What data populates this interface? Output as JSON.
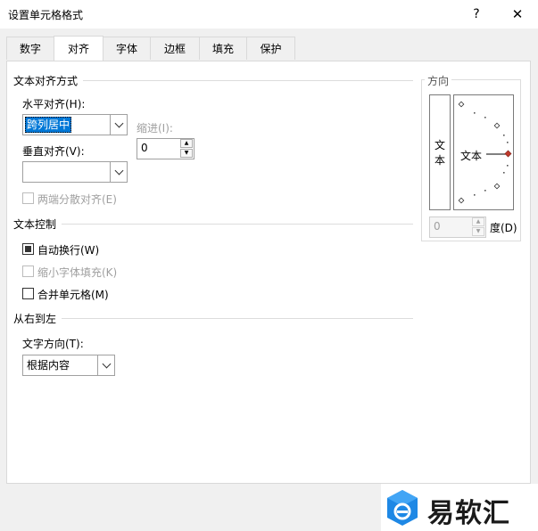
{
  "window": {
    "title": "设置单元格格式",
    "help_label": "?",
    "close_label": "✕"
  },
  "tabs": [
    {
      "label": "数字"
    },
    {
      "label": "对齐"
    },
    {
      "label": "字体"
    },
    {
      "label": "边框"
    },
    {
      "label": "填充"
    },
    {
      "label": "保护"
    }
  ],
  "alignment": {
    "section_title": "文本对齐方式",
    "horizontal_label": "水平对齐(H):",
    "horizontal_value": "跨列居中",
    "indent_label": "缩进(I):",
    "indent_value": "0",
    "vertical_label": "垂直对齐(V):",
    "vertical_value": "",
    "justify_distributed_label": "两端分散对齐(E)"
  },
  "text_control": {
    "section_title": "文本控制",
    "wrap_text_label": "自动换行(W)",
    "wrap_text_checked": true,
    "shrink_to_fit_label": "缩小字体填充(K)",
    "merge_cells_label": "合并单元格(M)"
  },
  "rtl": {
    "section_title": "从右到左",
    "direction_label": "文字方向(T):",
    "direction_value": "根据内容"
  },
  "orientation": {
    "group_title": "方向",
    "vertical_text_top": "文",
    "vertical_text_bottom": "本",
    "dial_text": "文本",
    "degrees_value": "0",
    "degrees_label": "度(D)"
  },
  "watermark": {
    "text": "易软汇",
    "colors": {
      "blue": "#1e88e5",
      "dark": "#1a1a1a"
    }
  },
  "colors": {
    "selection": "#0078d7",
    "dial_marker": "#c0392b"
  }
}
